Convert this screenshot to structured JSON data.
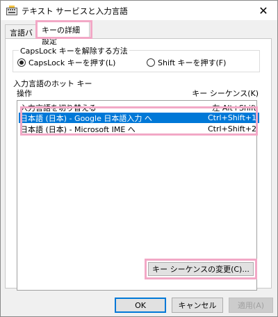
{
  "window": {
    "title": "テキスト サービスと入力言語",
    "close_glyph": "✕"
  },
  "tabs": [
    {
      "label": "言語バー"
    },
    {
      "label": "キーの詳細設定"
    }
  ],
  "capslock": {
    "title": "CapsLock キーを解除する方法",
    "options": [
      {
        "label": "CapsLock キーを押す(L)",
        "checked": true
      },
      {
        "label": "Shift キーを押す(F)",
        "checked": false
      }
    ]
  },
  "hotkeys": {
    "title": "入力言語のホット キー",
    "col_action": "操作",
    "col_sequence": "キー シーケンス(K)",
    "rows": [
      {
        "action": "入力言語を切り替える",
        "sequence": "左 Alt+Shift",
        "selected": false
      },
      {
        "action": "日本語 (日本) - Google 日本語入力 へ",
        "sequence": "Ctrl+Shift+1",
        "selected": true
      },
      {
        "action": "日本語 (日本) - Microsoft IME へ",
        "sequence": "Ctrl+Shift+2",
        "selected": false
      }
    ],
    "change_button": "キー シーケンスの変更(C)..."
  },
  "footer": {
    "ok": "OK",
    "cancel": "キャンセル",
    "apply": "適用(A)"
  },
  "colors": {
    "highlight": "#f2a8c6",
    "selection": "#0078d7"
  }
}
